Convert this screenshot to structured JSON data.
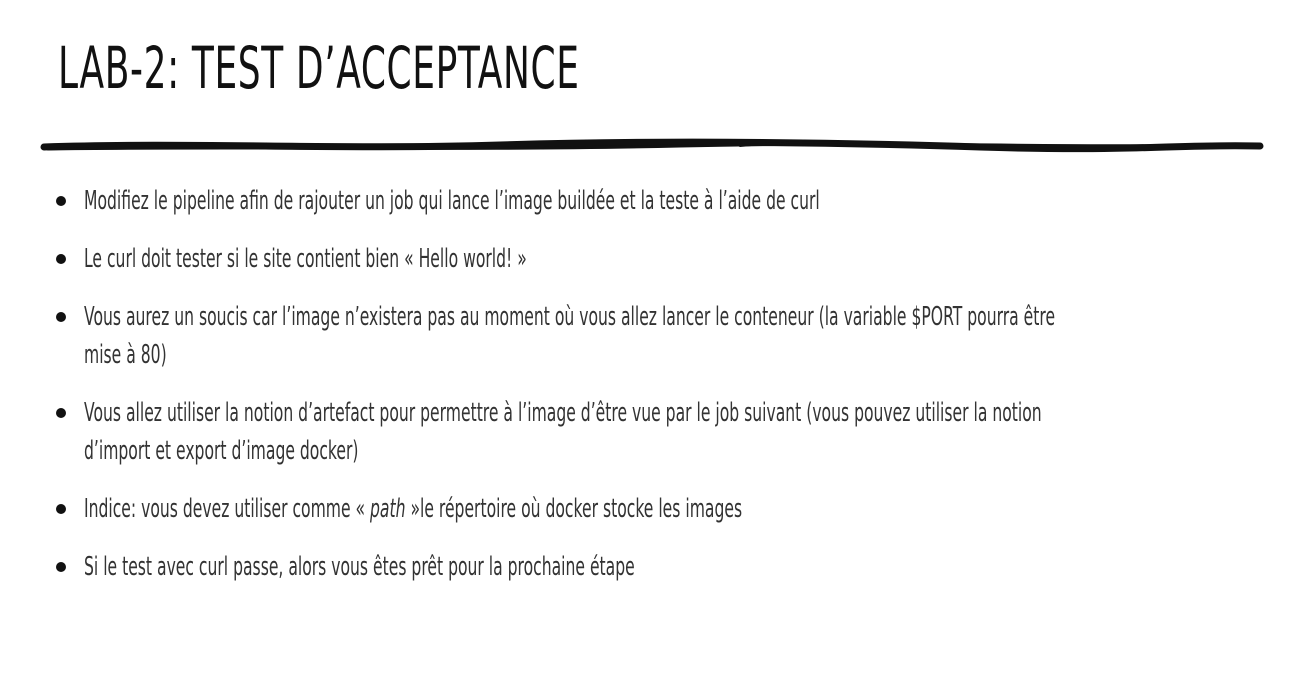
{
  "slide": {
    "title": "LAB-2: TEST D’ACCEPTANCE",
    "bullets": [
      {
        "lines": [
          "Modifiez le pipeline afin de rajouter un job qui lance l’image buildée et la teste à l’aide de curl"
        ]
      },
      {
        "lines": [
          "Le curl doit tester si le site contient bien «  Hello world! »"
        ]
      },
      {
        "lines": [
          "Vous aurez un soucis car l’image n’existera pas au moment où vous allez lancer le conteneur (la variable $PORT pourra être",
          "mise à 80)"
        ]
      },
      {
        "lines": [
          "Vous allez utiliser la notion d’artefact pour permettre à l’image d’être vue par le job suivant (vous pouvez utiliser la notion",
          "d’import et export d’image docker)"
        ]
      },
      {
        "parts": {
          "before": "Indice: vous devez utiliser comme « ",
          "emph": "path",
          "after": " »le répertoire où docker stocke les images"
        }
      },
      {
        "lines": [
          "Si le test avec curl passe, alors vous êtes prêt pour la prochaine étape"
        ]
      }
    ]
  },
  "colors": {
    "title": "#111111",
    "body_text": "#333333",
    "divider": "#111111"
  }
}
